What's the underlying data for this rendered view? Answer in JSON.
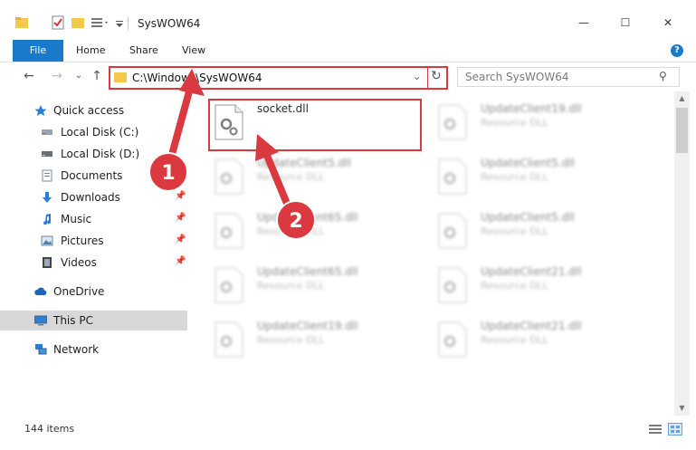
{
  "window": {
    "title": "SysWOW64",
    "minimize_glyph": "—",
    "maximize_glyph": "☐",
    "close_glyph": "✕"
  },
  "ribbon": {
    "tabs": [
      "File",
      "Home",
      "Share",
      "View"
    ],
    "help_glyph": "?"
  },
  "address": {
    "path": "C:\\Windows\\SysWOW64",
    "dropdown_glyph": "⌄",
    "refresh_glyph": "↻"
  },
  "search": {
    "placeholder": "Search SysWOW64",
    "icon": "⚲"
  },
  "nav_buttons": {
    "back": "←",
    "forward": "→",
    "recent": "⌄",
    "up": "↑"
  },
  "nav": {
    "quick_access": "Quick access",
    "items": [
      {
        "label": "Local Disk (C:)",
        "icon": "drive-icon",
        "pinned": false
      },
      {
        "label": "Local Disk (D:)",
        "icon": "drive-icon",
        "pinned": false
      },
      {
        "label": "Documents",
        "icon": "documents-icon",
        "pinned": false
      },
      {
        "label": "Downloads",
        "icon": "downloads-icon",
        "pinned": true
      },
      {
        "label": "Music",
        "icon": "music-icon",
        "pinned": true
      },
      {
        "label": "Pictures",
        "icon": "pictures-icon",
        "pinned": true
      },
      {
        "label": "Videos",
        "icon": "videos-icon",
        "pinned": true
      }
    ],
    "onedrive": "OneDrive",
    "this_pc": "This PC",
    "network": "Network",
    "pin_glyph": "📌"
  },
  "files": {
    "left": [
      {
        "name": "socket.dll",
        "desc": ""
      },
      {
        "name": "UpdateClient5.dll",
        "desc": "Resource DLL"
      },
      {
        "name": "UpdateClient65.dll",
        "desc": "Resource DLL"
      },
      {
        "name": "UpdateClient65.dll",
        "desc": "Resource DLL"
      },
      {
        "name": "UpdateClient19.dll",
        "desc": "Resource DLL"
      }
    ],
    "right": [
      {
        "name": "UpdateClient19.dll",
        "desc": "Resource DLL"
      },
      {
        "name": "UpdateClient5.dll",
        "desc": "Resource DLL"
      },
      {
        "name": "UpdateClient5.dll",
        "desc": "Resource DLL"
      },
      {
        "name": "UpdateClient21.dll",
        "desc": "Resource DLL"
      },
      {
        "name": "UpdateClient21.dll",
        "desc": "Resource DLL"
      }
    ]
  },
  "status": {
    "count": "144 items"
  },
  "annotations": {
    "badge1": "1",
    "badge2": "2"
  },
  "colors": {
    "accent": "#1979ca",
    "annotation_red": "#d9393f",
    "folder_yellow": "#f2c94a",
    "selected_nav": "#d8d8d8"
  }
}
